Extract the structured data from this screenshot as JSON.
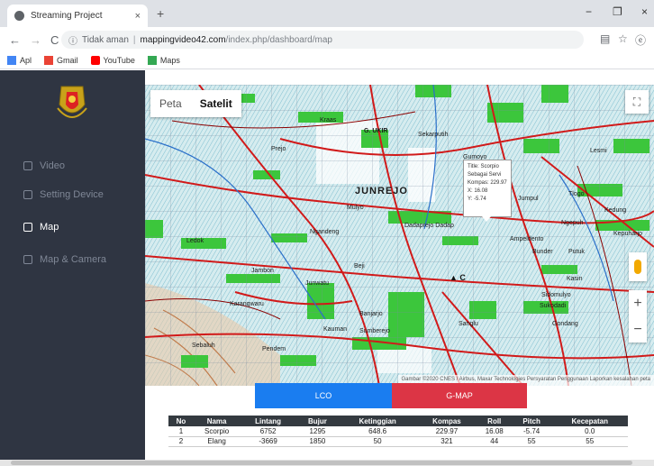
{
  "browser": {
    "tab_title": "Streaming Project",
    "tab_close": "×",
    "new_tab": "+",
    "win_minimize": "−",
    "win_maximize": "❐",
    "win_close": "×",
    "back": "←",
    "forward": "→",
    "reload": "C",
    "info_icon": "ⓘ",
    "secure_text": "Tidak aman",
    "separator": "|",
    "url_host": "mappingvideo42.com",
    "url_path": "/index.php/dashboard/map",
    "bookmark_icon": "☆",
    "profile_icon": "ⓔ",
    "bookmarks": [
      {
        "label": "Apl",
        "icon": "apps-icon",
        "color": "#4285f4"
      },
      {
        "label": "Gmail",
        "icon": "gmail-icon",
        "color": "#ea4335"
      },
      {
        "label": "YouTube",
        "icon": "youtube-icon",
        "color": "#ff0000"
      },
      {
        "label": "Maps",
        "icon": "maps-icon",
        "color": "#34a853"
      }
    ]
  },
  "sidebar": {
    "background": "#2f3542",
    "items": [
      {
        "label": "Video",
        "icon": "video-icon",
        "active": false
      },
      {
        "label": "Setting Device",
        "icon": "settings-icon",
        "active": false
      },
      {
        "label": "Map",
        "icon": "map-icon",
        "active": true
      },
      {
        "label": "Map & Camera",
        "icon": "map-camera-icon",
        "active": false
      }
    ]
  },
  "map": {
    "type_buttons": [
      {
        "label": "Peta",
        "selected": false
      },
      {
        "label": "Satelit",
        "selected": true
      }
    ],
    "fullscreen_icon": "⛶",
    "zoom_in": "+",
    "zoom_out": "−",
    "attribution": "Gambar ©2020 CNES / Airbus, Maxar Technologies   Persyaratan Penggunaan   Laporkan kesalahan peta",
    "place_labels": {
      "junrejo": "JUNREJO",
      "kraas": "Kraas",
      "gukir": "G. UKIR",
      "sekarputih": "Sekarputih",
      "gumoyo": "Gumoyo",
      "dadaprejo": "Dadaprejo Dadap",
      "ngandeng": "Ngandeng",
      "jambon": "Jambon",
      "junwatu": "Junwatu",
      "karangwaru": "Karangwaru",
      "banjarjo": "Banjarjo",
      "sumberejo": "Sumberejo",
      "kauman": "Kauman",
      "sebaluh": "Sebaluh",
      "beji": "Beji",
      "mulyo": "Mulyo",
      "pendem": "Pendem",
      "ampeldento": "Ampeldento",
      "bunder": "Bunder",
      "putuk": "Putuk",
      "kasin": "Kasin",
      "kepuharjo": "Kepuharjo",
      "ngepuh": "Ngepuh",
      "jumpul": "Jumpul",
      "lesmi": "Lesmi",
      "kedung": "Kedung",
      "tlogo": "Tlogo",
      "sidomulyo": "Sidomulyo",
      "sukodadi": "Sukodadi",
      "prejo": "Prejo",
      "ledok": "Ledok",
      "sanglu": "Sanglu",
      "gondang": "Gondang"
    },
    "info_window": {
      "title_line": "Title: Scorpio",
      "sub_line": "Sebagai Servi",
      "compass_line": "Kompas: 229.97",
      "x_line": "X: 16.08",
      "y_line": "Y: -5.74"
    },
    "marker_label": "▲ C"
  },
  "buttons": {
    "lco": {
      "label": "LCO",
      "color": "#1a7df0"
    },
    "gmap": {
      "label": "G-MAP",
      "color": "#dc3545"
    }
  },
  "table": {
    "headers": [
      "No",
      "Nama",
      "Lintang",
      "Bujur",
      "Ketinggian",
      "Kompas",
      "Roll",
      "Pitch",
      "Kecepatan"
    ],
    "rows": [
      [
        "1",
        "Scorpio",
        "6752",
        "1295",
        "648.6",
        "229.97",
        "16.08",
        "-5.74",
        "0.0"
      ],
      [
        "2",
        "Elang",
        "-3669",
        "1850",
        "50",
        "321",
        "44",
        "55",
        "55"
      ]
    ]
  }
}
